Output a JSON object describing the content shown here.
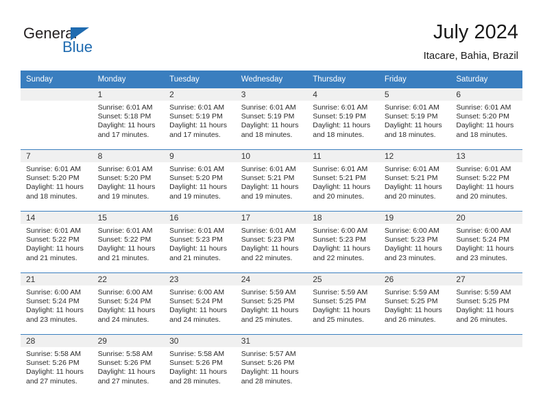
{
  "brand": {
    "name_top": "General",
    "name_bottom": "Blue",
    "triangle_color": "#1f6bb0"
  },
  "header": {
    "title": "July 2024",
    "subtitle": "Itacare, Bahia, Brazil"
  },
  "theme": {
    "header_bg": "#3a7ebf",
    "daynum_bg": "#f0f0f0",
    "text": "#2a2a2a"
  },
  "weekday_headers": [
    "Sunday",
    "Monday",
    "Tuesday",
    "Wednesday",
    "Thursday",
    "Friday",
    "Saturday"
  ],
  "weeks": [
    [
      {
        "day": "",
        "sunrise": "",
        "sunset": "",
        "daylight_line1": "",
        "daylight_line2": ""
      },
      {
        "day": "1",
        "sunrise": "Sunrise: 6:01 AM",
        "sunset": "Sunset: 5:18 PM",
        "daylight_line1": "Daylight: 11 hours",
        "daylight_line2": "and 17 minutes."
      },
      {
        "day": "2",
        "sunrise": "Sunrise: 6:01 AM",
        "sunset": "Sunset: 5:19 PM",
        "daylight_line1": "Daylight: 11 hours",
        "daylight_line2": "and 17 minutes."
      },
      {
        "day": "3",
        "sunrise": "Sunrise: 6:01 AM",
        "sunset": "Sunset: 5:19 PM",
        "daylight_line1": "Daylight: 11 hours",
        "daylight_line2": "and 18 minutes."
      },
      {
        "day": "4",
        "sunrise": "Sunrise: 6:01 AM",
        "sunset": "Sunset: 5:19 PM",
        "daylight_line1": "Daylight: 11 hours",
        "daylight_line2": "and 18 minutes."
      },
      {
        "day": "5",
        "sunrise": "Sunrise: 6:01 AM",
        "sunset": "Sunset: 5:19 PM",
        "daylight_line1": "Daylight: 11 hours",
        "daylight_line2": "and 18 minutes."
      },
      {
        "day": "6",
        "sunrise": "Sunrise: 6:01 AM",
        "sunset": "Sunset: 5:20 PM",
        "daylight_line1": "Daylight: 11 hours",
        "daylight_line2": "and 18 minutes."
      }
    ],
    [
      {
        "day": "7",
        "sunrise": "Sunrise: 6:01 AM",
        "sunset": "Sunset: 5:20 PM",
        "daylight_line1": "Daylight: 11 hours",
        "daylight_line2": "and 18 minutes."
      },
      {
        "day": "8",
        "sunrise": "Sunrise: 6:01 AM",
        "sunset": "Sunset: 5:20 PM",
        "daylight_line1": "Daylight: 11 hours",
        "daylight_line2": "and 19 minutes."
      },
      {
        "day": "9",
        "sunrise": "Sunrise: 6:01 AM",
        "sunset": "Sunset: 5:20 PM",
        "daylight_line1": "Daylight: 11 hours",
        "daylight_line2": "and 19 minutes."
      },
      {
        "day": "10",
        "sunrise": "Sunrise: 6:01 AM",
        "sunset": "Sunset: 5:21 PM",
        "daylight_line1": "Daylight: 11 hours",
        "daylight_line2": "and 19 minutes."
      },
      {
        "day": "11",
        "sunrise": "Sunrise: 6:01 AM",
        "sunset": "Sunset: 5:21 PM",
        "daylight_line1": "Daylight: 11 hours",
        "daylight_line2": "and 20 minutes."
      },
      {
        "day": "12",
        "sunrise": "Sunrise: 6:01 AM",
        "sunset": "Sunset: 5:21 PM",
        "daylight_line1": "Daylight: 11 hours",
        "daylight_line2": "and 20 minutes."
      },
      {
        "day": "13",
        "sunrise": "Sunrise: 6:01 AM",
        "sunset": "Sunset: 5:22 PM",
        "daylight_line1": "Daylight: 11 hours",
        "daylight_line2": "and 20 minutes."
      }
    ],
    [
      {
        "day": "14",
        "sunrise": "Sunrise: 6:01 AM",
        "sunset": "Sunset: 5:22 PM",
        "daylight_line1": "Daylight: 11 hours",
        "daylight_line2": "and 21 minutes."
      },
      {
        "day": "15",
        "sunrise": "Sunrise: 6:01 AM",
        "sunset": "Sunset: 5:22 PM",
        "daylight_line1": "Daylight: 11 hours",
        "daylight_line2": "and 21 minutes."
      },
      {
        "day": "16",
        "sunrise": "Sunrise: 6:01 AM",
        "sunset": "Sunset: 5:23 PM",
        "daylight_line1": "Daylight: 11 hours",
        "daylight_line2": "and 21 minutes."
      },
      {
        "day": "17",
        "sunrise": "Sunrise: 6:01 AM",
        "sunset": "Sunset: 5:23 PM",
        "daylight_line1": "Daylight: 11 hours",
        "daylight_line2": "and 22 minutes."
      },
      {
        "day": "18",
        "sunrise": "Sunrise: 6:00 AM",
        "sunset": "Sunset: 5:23 PM",
        "daylight_line1": "Daylight: 11 hours",
        "daylight_line2": "and 22 minutes."
      },
      {
        "day": "19",
        "sunrise": "Sunrise: 6:00 AM",
        "sunset": "Sunset: 5:23 PM",
        "daylight_line1": "Daylight: 11 hours",
        "daylight_line2": "and 23 minutes."
      },
      {
        "day": "20",
        "sunrise": "Sunrise: 6:00 AM",
        "sunset": "Sunset: 5:24 PM",
        "daylight_line1": "Daylight: 11 hours",
        "daylight_line2": "and 23 minutes."
      }
    ],
    [
      {
        "day": "21",
        "sunrise": "Sunrise: 6:00 AM",
        "sunset": "Sunset: 5:24 PM",
        "daylight_line1": "Daylight: 11 hours",
        "daylight_line2": "and 23 minutes."
      },
      {
        "day": "22",
        "sunrise": "Sunrise: 6:00 AM",
        "sunset": "Sunset: 5:24 PM",
        "daylight_line1": "Daylight: 11 hours",
        "daylight_line2": "and 24 minutes."
      },
      {
        "day": "23",
        "sunrise": "Sunrise: 6:00 AM",
        "sunset": "Sunset: 5:24 PM",
        "daylight_line1": "Daylight: 11 hours",
        "daylight_line2": "and 24 minutes."
      },
      {
        "day": "24",
        "sunrise": "Sunrise: 5:59 AM",
        "sunset": "Sunset: 5:25 PM",
        "daylight_line1": "Daylight: 11 hours",
        "daylight_line2": "and 25 minutes."
      },
      {
        "day": "25",
        "sunrise": "Sunrise: 5:59 AM",
        "sunset": "Sunset: 5:25 PM",
        "daylight_line1": "Daylight: 11 hours",
        "daylight_line2": "and 25 minutes."
      },
      {
        "day": "26",
        "sunrise": "Sunrise: 5:59 AM",
        "sunset": "Sunset: 5:25 PM",
        "daylight_line1": "Daylight: 11 hours",
        "daylight_line2": "and 26 minutes."
      },
      {
        "day": "27",
        "sunrise": "Sunrise: 5:59 AM",
        "sunset": "Sunset: 5:25 PM",
        "daylight_line1": "Daylight: 11 hours",
        "daylight_line2": "and 26 minutes."
      }
    ],
    [
      {
        "day": "28",
        "sunrise": "Sunrise: 5:58 AM",
        "sunset": "Sunset: 5:26 PM",
        "daylight_line1": "Daylight: 11 hours",
        "daylight_line2": "and 27 minutes."
      },
      {
        "day": "29",
        "sunrise": "Sunrise: 5:58 AM",
        "sunset": "Sunset: 5:26 PM",
        "daylight_line1": "Daylight: 11 hours",
        "daylight_line2": "and 27 minutes."
      },
      {
        "day": "30",
        "sunrise": "Sunrise: 5:58 AM",
        "sunset": "Sunset: 5:26 PM",
        "daylight_line1": "Daylight: 11 hours",
        "daylight_line2": "and 28 minutes."
      },
      {
        "day": "31",
        "sunrise": "Sunrise: 5:57 AM",
        "sunset": "Sunset: 5:26 PM",
        "daylight_line1": "Daylight: 11 hours",
        "daylight_line2": "and 28 minutes."
      },
      {
        "day": "",
        "sunrise": "",
        "sunset": "",
        "daylight_line1": "",
        "daylight_line2": ""
      },
      {
        "day": "",
        "sunrise": "",
        "sunset": "",
        "daylight_line1": "",
        "daylight_line2": ""
      },
      {
        "day": "",
        "sunrise": "",
        "sunset": "",
        "daylight_line1": "",
        "daylight_line2": ""
      }
    ]
  ]
}
